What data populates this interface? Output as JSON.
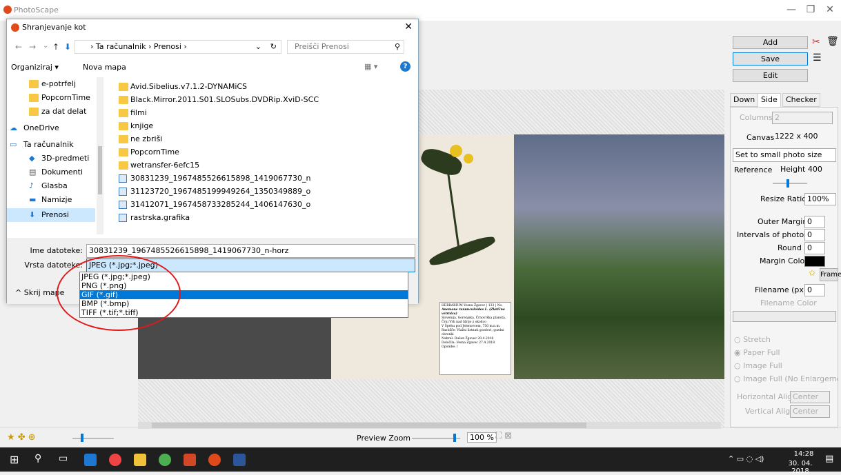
{
  "app": {
    "title": "PhotoScape"
  },
  "right": {
    "add": "Add",
    "save": "Save",
    "edit": "Edit",
    "tabs": [
      "Down",
      "Side",
      "Checker"
    ],
    "columns_label": "Columns",
    "columns_value": "2",
    "canvas_label": "Canvas",
    "canvas_value": "1222 x 400",
    "size_mode": "Set to small photo size",
    "reference_label": "Reference",
    "reference_value": "Height 400",
    "resize_label": "Resize Ratio",
    "resize_value": "100%",
    "outer_margin_label": "Outer Margin",
    "outer_margin_value": "0",
    "intervals_label": "Intervals of photos",
    "intervals_value": "0",
    "round_label": "Round",
    "round_value": "0",
    "margin_color_label": "Margin Color",
    "frame_label": "Frame",
    "filename_label": "Filename (px)",
    "filename_value": "0",
    "filename_color_label": "Filename Color",
    "fit_options": [
      "Stretch",
      "Paper Full",
      "Image Full",
      "Image Full (No Enlargement"
    ],
    "halign_label": "Horizontal Align",
    "halign_value": "Center",
    "valign_label": "Vertical Align",
    "valign_value": "Center"
  },
  "bottom": {
    "zoom_label": "Preview Zoom",
    "zoom_value": "100 %"
  },
  "taskbar": {
    "time": "14:28",
    "date": "30. 04. 2018"
  },
  "dialog": {
    "title": "Shranjevanje kot",
    "path": [
      "Ta računalnik",
      "Prenosi"
    ],
    "search_placeholder": "Preišči Prenosi",
    "organize": "Organiziraj ▾",
    "new_folder": "Nova mapa",
    "tree": [
      "e-potrfelj",
      "PopcornTime",
      "za dat delat",
      "OneDrive",
      "Ta računalnik",
      "3D-predmeti",
      "Dokumenti",
      "Glasba",
      "Namizje",
      "Prenosi"
    ],
    "files": [
      "Avid.Sibelius.v7.1.2-DYNAMiCS",
      "Black.Mirror.2011.S01.SLOSubs.DVDRip.XviD-SCC",
      "filmi",
      "knjige",
      "ne zbriši",
      "PopcornTime",
      "wetransfer-6efc15",
      "30831239_1967485526615898_1419067730_n",
      "31123720_1967485199949264_1350349889_o",
      "31412071_1967458733285244_1406147630_o",
      "rastrska.grafika"
    ],
    "filename_label": "Ime datoteke:",
    "filename_value": "30831239_1967485526615898_1419067730_n-horz",
    "type_label": "Vrsta datoteke:",
    "type_value": "JPEG (*.jpg;*.jpeg)",
    "type_options": [
      "JPEG (*.jpg;*.jpeg)",
      "PNG (*.png)",
      "GIF (*.gif)",
      "BMP (*.bmp)",
      "TIFF (*.tif;*.tiff)"
    ],
    "hide_folders": "Skrij mape"
  },
  "herbarium": {
    "label_lines": [
      "HERBARIUM Vesna Žgavec | 133 | No.",
      "Anemone ranunculoides L. (Zlatična vetrnica)",
      "Slovenija, Gorenjska, Črnovrška planota, Črni Vrh nad Idrijo z okolico",
      "V Špehu pod Jelenovcem, 750 m.n.m.",
      "Rastišče: Vlažni listnati gozdovi, gozdni obronki",
      "Nabral: Dušan Žgavec 20.4.2018",
      "Določila: Vesna Žgavec 27.4.2018",
      "Opombe: /"
    ]
  }
}
